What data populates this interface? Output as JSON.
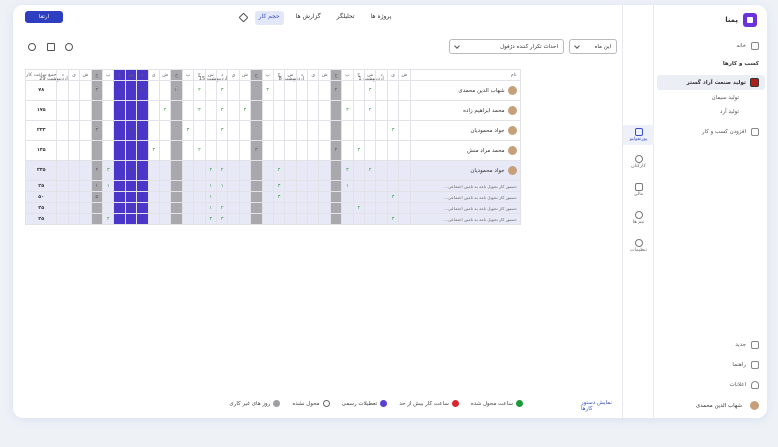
{
  "app": {
    "logo": "پمنا"
  },
  "sidebar": {
    "home": "خانه",
    "section": "کسب و کارها",
    "active_business": "تولید صنعت آراد گستر",
    "subs": [
      "تولید سیمان",
      "تولید آرد"
    ],
    "add_business": "افزودن کسب و کار",
    "new": "جدید",
    "guide": "راهنما",
    "notifications": "اعلانات",
    "user": "شهاب الدین محمدی"
  },
  "rail": [
    {
      "label": "پورتفولیو",
      "icon": "grid-icon"
    },
    {
      "label": "کارکنان",
      "icon": "people-icon"
    },
    {
      "label": "مالی",
      "icon": "wallet-icon"
    },
    {
      "label": "تیم ها",
      "icon": "team-icon"
    },
    {
      "label": "تنظیمات",
      "icon": "gear-icon"
    }
  ],
  "tabs": [
    "پروژه ها",
    "تحلیلگر",
    "گزارش ها",
    "حجم کار"
  ],
  "primary_button": "ارتقا",
  "filters": {
    "period": "این ماه",
    "event": "احداث تکرار کننده دژفول"
  },
  "weeks": [
    "1 اردیبهشت",
    "8 اردیبهشت",
    "15 اردیبهشت",
    "22 اردیبهشت",
    "29 اردیبهشت"
  ],
  "grid": {
    "name_header": "نام",
    "total_header": "جمع ساعت کار",
    "days": [
      "ش",
      "ی",
      "د",
      "س",
      "چ",
      "پ",
      "ج",
      "ش",
      "ی",
      "د",
      "س",
      "چ",
      "پ",
      "ج",
      "ش",
      "ی",
      "د",
      "س",
      "چ",
      "پ",
      "ج",
      "ش",
      "ی",
      "د",
      "س",
      "چ",
      "پ",
      "ج",
      "ش",
      "ی",
      "د"
    ],
    "rows": [
      {
        "type": "main",
        "name": "شهاب الدین محمدی",
        "total": "۷۸",
        "cells": {
          "3": "۳",
          "6": "۲",
          "12": "۳",
          "16": "۳",
          "18": "۲",
          "20": "۱۰",
          "23": "۳",
          "25": "۲",
          "27": "۳"
        }
      },
      {
        "type": "main",
        "name": "محمد ابراهیم زاده",
        "total": "۱۷۵",
        "cells": {
          "3": "۲",
          "5": "۳",
          "14": "۳",
          "16": "۳",
          "18": "۳",
          "21": "۲",
          "25": "۲"
        }
      },
      {
        "type": "main",
        "name": "جواد محمودیان",
        "total": "۲۴۳",
        "cells": {
          "1": "۳",
          "16": "۳",
          "19": "۳",
          "24": "۳",
          "27": "۳"
        }
      },
      {
        "type": "main",
        "name": "محمد مراد منش",
        "total": "۱۴۵",
        "cells": {
          "4": "۳",
          "6": "۲",
          "13": "۳",
          "18": "۲",
          "22": "۳"
        }
      },
      {
        "type": "main",
        "name": "جواد محمودیان",
        "total": "۲۴۵",
        "cells": {
          "3": "۲",
          "5": "۳",
          "11": "۲",
          "16": "۲",
          "17": "۲",
          "24": "۳",
          "26": "۳",
          "27": "۲"
        }
      },
      {
        "type": "sub",
        "name": "دستور کار تحویل نامه به تامین اجتماعی...",
        "total": "۲۵",
        "cells": {
          "5": "۱",
          "11": "۳",
          "16": "۱",
          "17": "۱",
          "26": "۱",
          "27": "۱"
        }
      },
      {
        "type": "sub",
        "name": "دستور کار تحویل نامه به تامین اجتماعی...",
        "total": "۵۰",
        "cells": {
          "1": "۳",
          "11": "۳",
          "17": "۱",
          "27": "۵"
        }
      },
      {
        "type": "sub",
        "name": "دستور کار تحویل نامه به تامین اجتماعی...",
        "total": "۲۵",
        "cells": {
          "4": "۲",
          "16": "۲",
          "17": "۱",
          "24": "۲"
        }
      },
      {
        "type": "sub",
        "name": "دستور کار تحویل نامه به تامین اجتماعی...",
        "total": "۲۵",
        "cells": {
          "1": "۳",
          "16": "۳",
          "17": "۳",
          "26": "۲"
        }
      }
    ]
  },
  "legend": [
    {
      "label": "ساعت محول شده",
      "color": "#1a9a3a"
    },
    {
      "label": "ساعت کار بیش از حد",
      "color": "#d9262e"
    },
    {
      "label": "تعطیلات رسمی",
      "color": "#5b3fd0"
    },
    {
      "label": "محول نشده",
      "color": "#ffffff"
    },
    {
      "label": "روز های غیر کاری",
      "color": "#9e9ea3"
    }
  ],
  "show_tasks": "نمایش دستور کارها"
}
